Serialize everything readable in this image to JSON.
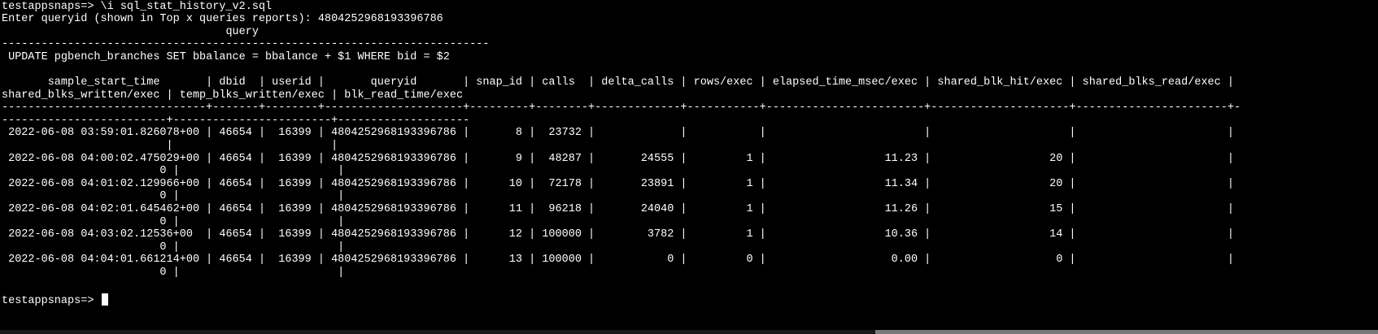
{
  "terminal": {
    "lines": [
      "testappsnaps=> \\i sql_stat_history_v2.sql",
      "Enter queryid (shown in Top x queries reports): 4804252968193396786",
      "                                  query",
      "--------------------------------------------------------------------------",
      " UPDATE pgbench_branches SET bbalance = bbalance + $1 WHERE bid = $2",
      "",
      "       sample_start_time       | dbid  | userid |       queryid       | snap_id | calls  | delta_calls | rows/exec | elapsed_time_msec/exec | shared_blk_hit/exec | shared_blks_read/exec |",
      "shared_blks_written/exec | temp_blks_written/exec | blk_read_time/exec",
      "-------------------------------+-------+--------+---------------------+---------+--------+-------------+-----------+------------------------+---------------------+-----------------------+-",
      "-------------------------+------------------------+--------------------",
      " 2022-06-08 03:59:01.826078+00 | 46654 |  16399 | 4804252968193396786 |       8 |  23732 |             |           |                        |                     |                       |",
      "                         |                        |",
      " 2022-06-08 04:00:02.475029+00 | 46654 |  16399 | 4804252968193396786 |       9 |  48287 |       24555 |         1 |                  11.23 |                  20 |                       |",
      "                        0 |                        |",
      " 2022-06-08 04:01:02.129966+00 | 46654 |  16399 | 4804252968193396786 |      10 |  72178 |       23891 |         1 |                  11.34 |                  20 |                       |",
      "                        0 |                        |",
      " 2022-06-08 04:02:01.645462+00 | 46654 |  16399 | 4804252968193396786 |      11 |  96218 |       24040 |         1 |                  11.26 |                  15 |                       |",
      "                        0 |                        |",
      " 2022-06-08 04:03:02.12536+00  | 46654 |  16399 | 4804252968193396786 |      12 | 100000 |        3782 |         1 |                  10.36 |                  14 |                       |",
      "                        0 |                        |",
      " 2022-06-08 04:04:01.661214+00 | 46654 |  16399 | 4804252968193396786 |      13 | 100000 |           0 |         0 |                   0.00 |                   0 |                       |",
      "                        0 |                        |",
      "",
      "testappsnaps=> "
    ]
  },
  "colors": {
    "background": "#000000",
    "foreground": "#ffffff"
  }
}
